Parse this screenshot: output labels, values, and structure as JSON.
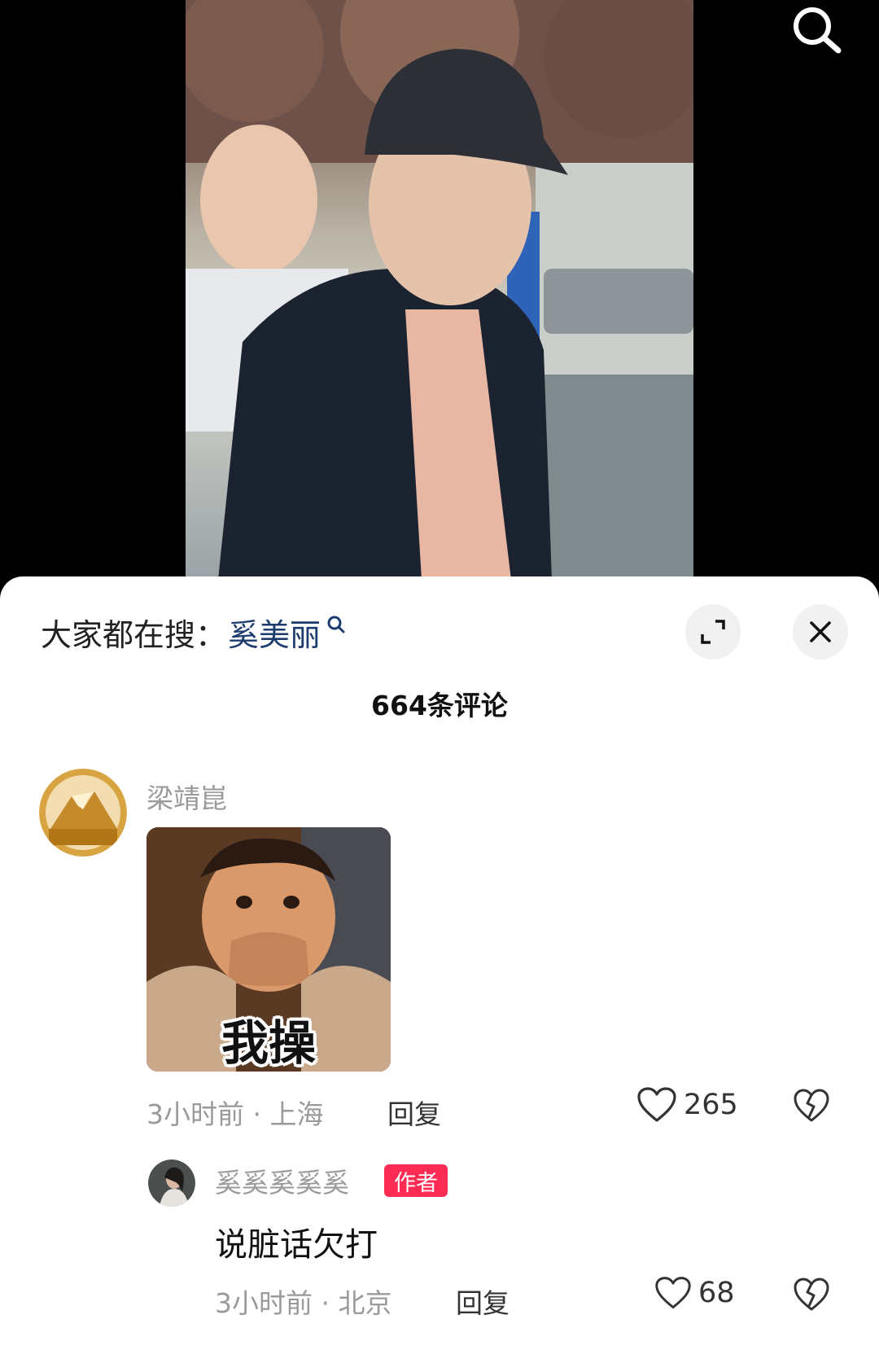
{
  "trending": {
    "prefix": "大家都在搜：",
    "keyword": "奚美丽"
  },
  "comments_header": {
    "count_label": "664条评论"
  },
  "comment": {
    "username": "梁靖崑",
    "meme_caption": "我操",
    "time": "3小时前",
    "location": "上海",
    "meta": "3小时前 · 上海",
    "reply_label": "回复",
    "likes": "265"
  },
  "reply": {
    "username": "奚奚奚奚奚",
    "badge": "作者",
    "text": "说脏话欠打",
    "time": "3小时前",
    "location": "北京",
    "meta": "3小时前 · 北京",
    "reply_label": "回复",
    "likes": "68"
  },
  "icons": {
    "top_search": "search-icon",
    "trending_search": "search-icon",
    "expand": "expand-icon",
    "close": "close-icon",
    "like": "heart-icon",
    "dislike": "broken-heart-icon"
  },
  "colors": {
    "keyword": "#1c3b6e",
    "badge": "#fe2c55",
    "meta": "#9a9a9a"
  }
}
